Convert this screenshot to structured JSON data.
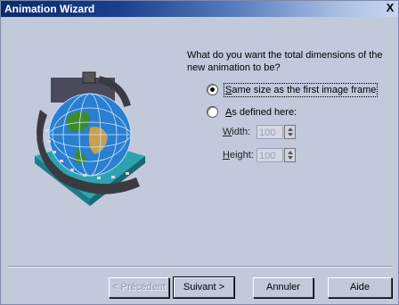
{
  "window": {
    "title": "Animation Wizard",
    "close_glyph": "X"
  },
  "question": "What do you want the total dimensions of the new animation to be?",
  "options": {
    "same_size": {
      "label": "Same size as the first image frame",
      "checked": true
    },
    "as_defined": {
      "label": "As defined here:",
      "checked": false
    }
  },
  "fields": {
    "width": {
      "label": "Width:",
      "value": "100"
    },
    "height": {
      "label": "Height:",
      "value": "100"
    }
  },
  "buttons": {
    "back": "< Précédent",
    "next": "Suivant >",
    "cancel": "Annuler",
    "help": "Aide"
  },
  "icons": {
    "art": "globe-filmstrip-icon",
    "close": "close-icon",
    "spinner": "spinner-icon"
  }
}
